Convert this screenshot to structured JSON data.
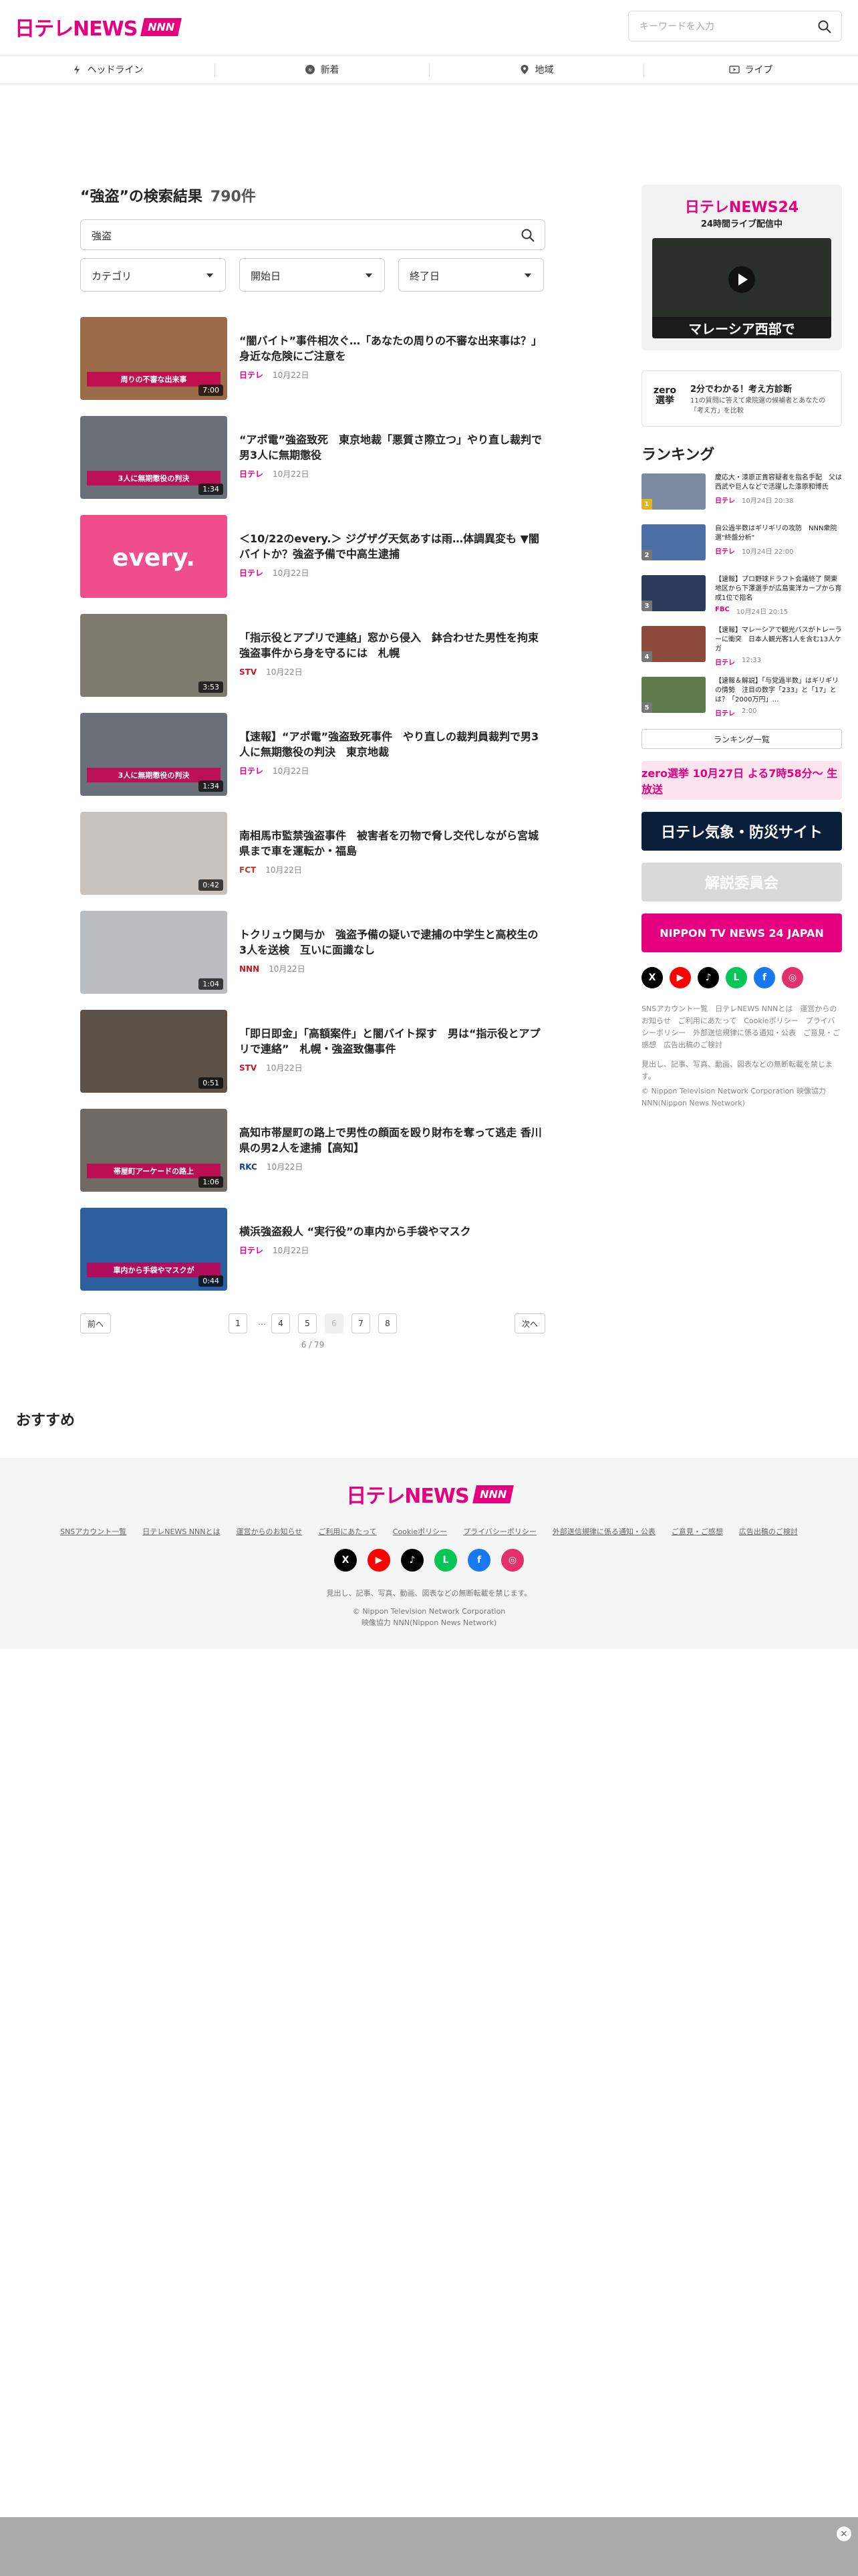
{
  "brand": {
    "logo_text": "日テレNEWS",
    "logo_badge": "NNN",
    "accent": "#e4007f"
  },
  "search": {
    "placeholder": "キーワードを入力"
  },
  "nav": [
    {
      "label": "ヘッドライン",
      "icon": "lightning-icon"
    },
    {
      "label": "新着",
      "icon": "new-icon"
    },
    {
      "label": "地域",
      "icon": "map-pin-icon"
    },
    {
      "label": "ライブ",
      "icon": "live-icon"
    }
  ],
  "results": {
    "heading": "“強盗”の検索結果",
    "count": "790件",
    "query": "強盗",
    "filters": {
      "category": "カテゴリ",
      "start": "開始日",
      "end": "終了日"
    }
  },
  "articles": [
    {
      "title": "“闇バイト”事件相次ぐ…「あなたの周りの不審な出来事は？」 身近な危険にご注意を",
      "source": "日テレ",
      "date": "10月22日",
      "duration": "7:00",
      "thumb_color": "#9b6b4a",
      "thumb_caption": "周りの不審な出来事",
      "src_color": "#e4007f"
    },
    {
      "title": "“アポ電”強盗致死　東京地裁「悪質さ際立つ」やり直し裁判で男3人に無期懲役",
      "source": "日テレ",
      "date": "10月22日",
      "duration": "1:34",
      "thumb_color": "#6a6f78",
      "thumb_caption": "3人に無期懲役の判決",
      "src_color": "#e4007f"
    },
    {
      "title": "＜10/22のevery.＞ ジグザグ天気あすは雨…体調異変も ▼闇バイトか？強盗予備で中高生逮捕",
      "source": "日テレ",
      "date": "10月22日",
      "duration": "",
      "thumb_color": "#f04d8c",
      "thumb_caption": "every.",
      "src_color": "#e4007f"
    },
    {
      "title": "「指示役とアプリで連絡」窓から侵入　鉢合わせた男性を拘束　強盗事件から身を守るには　札幌",
      "source": "STV",
      "date": "10月22日",
      "duration": "3:53",
      "thumb_color": "#7d7a70",
      "thumb_caption": "",
      "src_color": "#d0151c"
    },
    {
      "title": "【速報】“アポ電”強盗致死事件　やり直しの裁判員裁判で男3人に無期懲役の判決　東京地裁",
      "source": "日テレ",
      "date": "10月22日",
      "duration": "1:34",
      "thumb_color": "#6a6f78",
      "thumb_caption": "3人に無期懲役の判決",
      "src_color": "#e4007f"
    },
    {
      "title": "南相馬市監禁強盗事件　被害者を刃物で脅し交代しながら宮城県まで車を運転か・福島",
      "source": "FCT",
      "date": "10月22日",
      "duration": "0:42",
      "thumb_color": "#c8c2be",
      "thumb_caption": "",
      "src_color": "#c0392b"
    },
    {
      "title": "トクリュウ関与か　強盗予備の疑いで逮捕の中学生と高校生の3人を送検　互いに面識なし",
      "source": "NNN",
      "date": "10月22日",
      "duration": "1:04",
      "thumb_color": "#b9bcc0",
      "thumb_caption": "",
      "src_color": "#d0151c"
    },
    {
      "title": "「即日即金」「高額案件」と闇バイト探す　男は“指示役とアプリで連絡”　札幌・強盗致傷事件",
      "source": "STV",
      "date": "10月22日",
      "duration": "0:51",
      "thumb_color": "#5b5148",
      "thumb_caption": "",
      "src_color": "#d0151c"
    },
    {
      "title": "高知市帯屋町の路上で男性の顔面を殴り財布を奪って逃走 香川県の男2人を逮捕【高知】",
      "source": "RKC",
      "date": "10月22日",
      "duration": "1:06",
      "thumb_color": "#6f6a66",
      "thumb_caption": "帯屋町アーケードの路上",
      "src_color": "#1a3e8c"
    },
    {
      "title": "横浜強盗殺人 “実行役”の車内から手袋やマスク",
      "source": "日テレ",
      "date": "10月22日",
      "duration": "0:44",
      "thumb_color": "#2d5e9e",
      "thumb_caption": "車内から手袋やマスクが",
      "src_color": "#e4007f"
    }
  ],
  "pager": {
    "prev": "前へ",
    "next": "次へ",
    "pages": [
      "1",
      "…",
      "4",
      "5",
      "6",
      "7",
      "8"
    ],
    "active": "6",
    "status": "6 / 79"
  },
  "sidebar": {
    "live_logo": "日テレNEWS24",
    "live_sub": "24時間ライブ配信中",
    "live_caption": "マレーシア西部で",
    "zero": {
      "logo": "zero選挙",
      "title": "2分でわかる！考え方診断",
      "desc": "11の質問に答えて衆院選の候補者とあなたの「考え方」を比較"
    },
    "ranking_heading": "ランキング",
    "ranking": [
      {
        "rank": "1",
        "title": "慶応大・漆原正貴容疑者を指名手配　父は西武や巨人などで活躍した漆原和博氏",
        "source": "日テレ",
        "date": "10月24日 20:38",
        "color": "#7a8aa0"
      },
      {
        "rank": "2",
        "title": "自公過半数はギリギリの攻防　NNN衆院選\"終盤分析\"",
        "source": "日テレ",
        "date": "10月24日 22:00",
        "color": "#4a6fa5"
      },
      {
        "rank": "3",
        "title": "【速報】プロ野球ドラフト会議終了 関東地区から下澤選手が広島東洋カープから育成1位で指名",
        "source": "FBC",
        "date": "10月24日 20:15",
        "color": "#2a3b5c"
      },
      {
        "rank": "4",
        "title": "【速報】マレーシアで観光バスがトレーラーに衝突　日本人観光客1人を含む13人ケガ",
        "source": "日テレ",
        "date": "12:33",
        "color": "#8c4a3a"
      },
      {
        "rank": "5",
        "title": "【速報＆解説】「与党過半数」はギリギリの情勢　注目の数字「233」と「17」とは？「2000万円」…",
        "source": "日テレ",
        "date": "2:00",
        "color": "#5c7a4a"
      }
    ],
    "ranking_more": "ランキング一覧",
    "banners": [
      {
        "text": "zero選挙 10月27日 よる7時58分～ 生放送",
        "bg": "#fbe4ee",
        "fg": "#e4007f"
      },
      {
        "text": "日テレ気象・防災サイト",
        "bg": "#0a1f3a",
        "fg": "#ffffff"
      },
      {
        "text": "解説委員会",
        "bg": "#d9d9d9",
        "fg": "#ffffff"
      },
      {
        "text": "NIPPON TV NEWS 24 JAPAN",
        "bg": "#e4007f",
        "fg": "#ffffff"
      }
    ],
    "social": [
      {
        "icon": "x-icon",
        "glyph": "X",
        "color": "#000000"
      },
      {
        "icon": "youtube-icon",
        "glyph": "▶",
        "color": "#ff0000"
      },
      {
        "icon": "tiktok-icon",
        "glyph": "♪",
        "color": "#000000"
      },
      {
        "icon": "line-icon",
        "glyph": "L",
        "color": "#06c755"
      },
      {
        "icon": "facebook-icon",
        "glyph": "f",
        "color": "#1877f2"
      },
      {
        "icon": "instagram-icon",
        "glyph": "◎",
        "color": "#e1306c"
      }
    ],
    "links": "SNSアカウント一覧　日テレNEWS NNNとは　運営からのお知らせ　ご利用にあたって　Cookieポリシー　プライバシーポリシー　外部送信規律に係る通知・公表　ご意見・ご感想　広告出稿のご検討",
    "note": "見出し、記事、写真、動画、図表などの無断転載を禁じます。",
    "copy": "© Nippon Television Network Corporation 映像協力 NNN(Nippon News Network)"
  },
  "recommend_heading": "おすすめ",
  "footer": {
    "links": [
      "SNSアカウント一覧",
      "日テレNEWS NNNとは",
      "運営からのお知らせ",
      "ご利用にあたって",
      "Cookieポリシー",
      "プライバシーポリシー",
      "外部送信規律に係る通知・公表",
      "ご意見・ご感想",
      "広告出稿のご検討"
    ],
    "note": "見出し、記事、写真、動画、図表などの無断転載を禁じます。",
    "copy1": "© Nippon Television Network Corporation",
    "copy2": "映像協力 NNN(Nippon News Network)"
  },
  "close_label": "×"
}
